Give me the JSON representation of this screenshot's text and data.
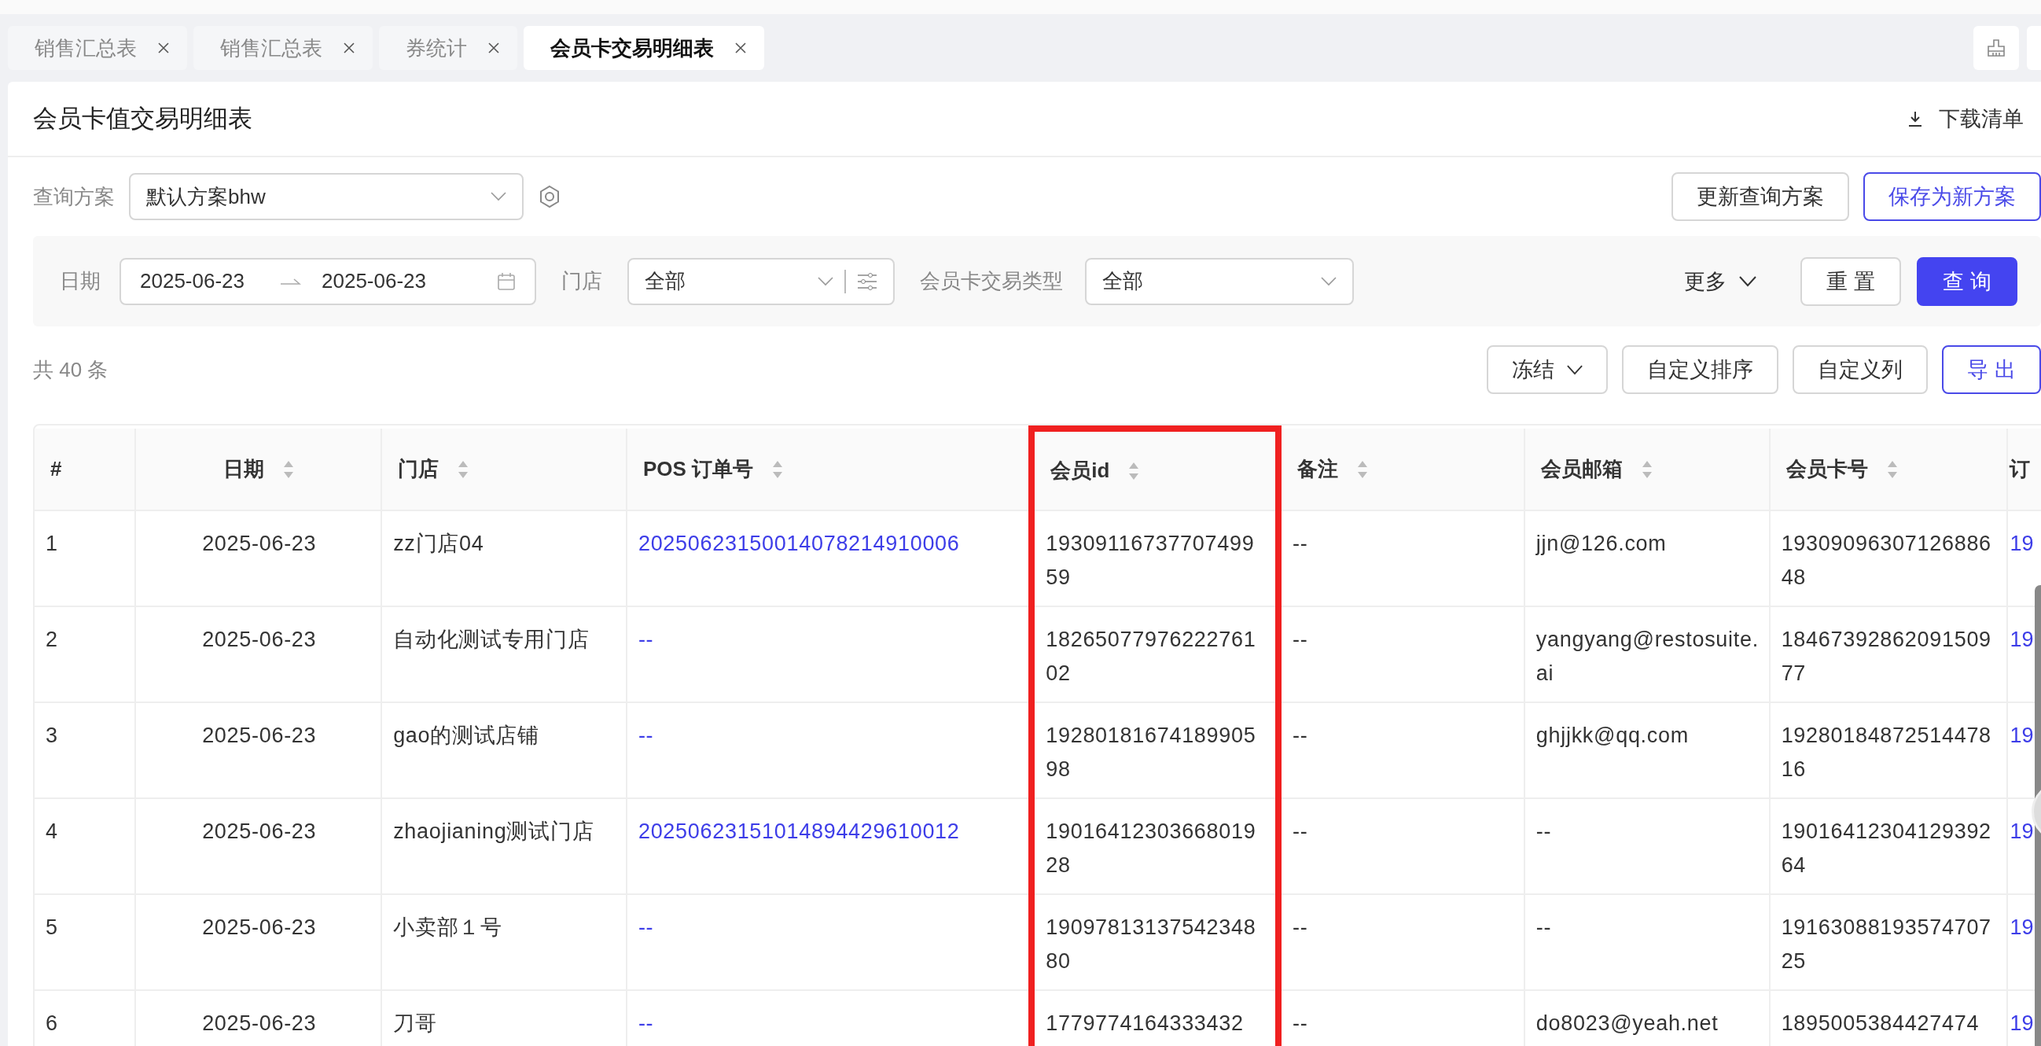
{
  "tabs": [
    {
      "label": "销售汇总表",
      "selected": false
    },
    {
      "label": "销售汇总表",
      "selected": false
    },
    {
      "label": "券统计",
      "selected": false
    },
    {
      "label": "会员卡交易明细表",
      "selected": true
    }
  ],
  "page": {
    "title": "会员卡值交易明细表",
    "download": "下载清单"
  },
  "scheme": {
    "label": "查询方案",
    "value": "默认方案bhw",
    "buttons": [
      {
        "label": "更新查询方案",
        "kind": "default"
      },
      {
        "label": "保存为新方案",
        "kind": "outline"
      }
    ]
  },
  "filters": {
    "date": {
      "label": "日期",
      "start": "2025-06-23",
      "end": "2025-06-23"
    },
    "store": {
      "label": "门店",
      "value": "全部"
    },
    "type": {
      "label": "会员卡交易类型",
      "value": "全部"
    },
    "more": "更多",
    "reset": "重 置",
    "query": "查 询"
  },
  "total": "共 40 条",
  "table_actions": [
    {
      "label": "冻结",
      "kind": "dropdown"
    },
    {
      "label": "自定义排序",
      "kind": "default"
    },
    {
      "label": "自定义列",
      "kind": "default"
    },
    {
      "label": "导 出",
      "kind": "outline"
    }
  ],
  "table": {
    "columns": [
      {
        "label": "#",
        "sortable": false,
        "highlighted": false,
        "kind": "text"
      },
      {
        "label": "日期",
        "sortable": true,
        "highlighted": false,
        "kind": "center"
      },
      {
        "label": "门店",
        "sortable": true,
        "highlighted": false,
        "kind": "text"
      },
      {
        "label": "POS 订单号",
        "sortable": true,
        "highlighted": false,
        "kind": "link"
      },
      {
        "label": "会员id",
        "sortable": true,
        "highlighted": true,
        "kind": "text"
      },
      {
        "label": "备注",
        "sortable": true,
        "highlighted": false,
        "kind": "text"
      },
      {
        "label": "会员邮箱",
        "sortable": true,
        "highlighted": false,
        "kind": "text"
      },
      {
        "label": "会员卡号",
        "sortable": true,
        "highlighted": false,
        "kind": "text"
      },
      {
        "label": "订",
        "highlighted": false,
        "kind": "link"
      }
    ],
    "rows": [
      [
        "1",
        "2025-06-23",
        "zz门店04",
        "20250623150014078214910006",
        "1930911673770749959",
        "--",
        "jjn@126.com",
        "1930909630712688648",
        "19"
      ],
      [
        "2",
        "2025-06-23",
        "自动化测试专用门店",
        "--",
        "1826507797622276102",
        "--",
        "yangyang@restosuite.ai",
        "1846739286209150977",
        "19"
      ],
      [
        "3",
        "2025-06-23",
        "gao的测试店铺",
        "--",
        "1928018167418990598",
        "--",
        "ghjjkk@qq.com",
        "1928018487251447816",
        "19"
      ],
      [
        "4",
        "2025-06-23",
        "zhaojianing测试门店",
        "20250623151014894429610012",
        "1901641230366801928",
        "--",
        "--",
        "1901641230412939264",
        "19"
      ],
      [
        "5",
        "2025-06-23",
        "小卖部１号",
        "--",
        "1909781313754234880",
        "--",
        "--",
        "1916308819357470725",
        "19"
      ],
      [
        "6",
        "2025-06-23",
        "刀哥",
        "--",
        "1779774164333432",
        "--",
        "do8023@yeah.net",
        "1895005384427474",
        "19"
      ]
    ]
  }
}
